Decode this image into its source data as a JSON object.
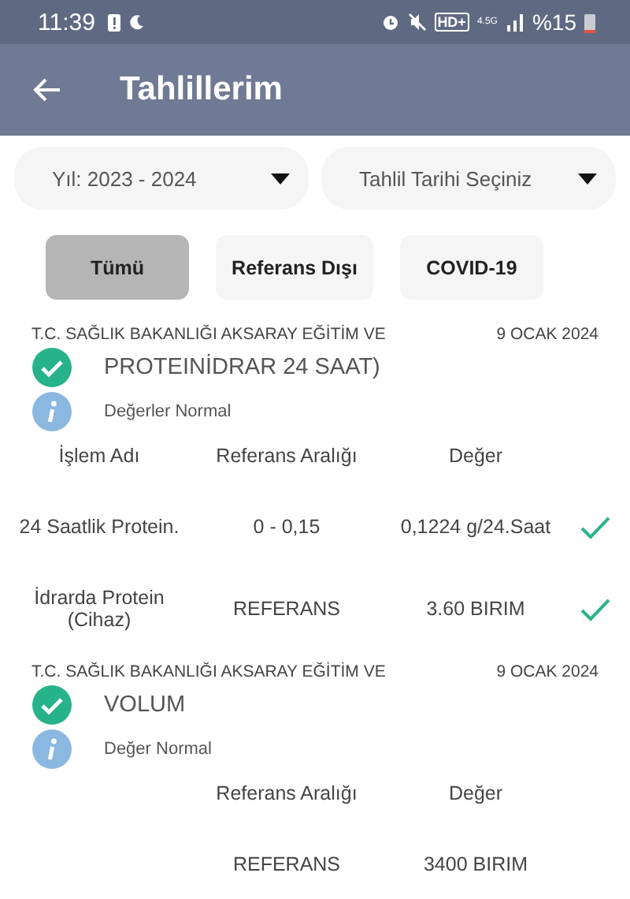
{
  "status_bar": {
    "time": "11:39",
    "hd": "HD+",
    "network": "4.5G",
    "battery": "%15"
  },
  "header": {
    "title": "Tahlillerim"
  },
  "dropdowns": [
    {
      "value": "Yıl: 2023 - 2024"
    },
    {
      "value": "Tahlil Tarihi Seçiniz"
    }
  ],
  "filters": [
    {
      "label": "Tümü",
      "selected": true
    },
    {
      "label": "Referans Dışı",
      "selected": false
    },
    {
      "label": "COVID-19",
      "selected": false
    }
  ],
  "results": [
    {
      "institution": "T.C. SAĞLIK BAKANLIĞI AKSARAY EĞİTİM VE",
      "date": "9 OCAK 2024",
      "test": "PROTEINİDRAR 24 SAAT)",
      "normal": true,
      "note": "Değerler Normal",
      "columns": [
        "İşlem Adı",
        "Referans Aralığı",
        "Değer"
      ],
      "rows": [
        {
          "cells": [
            "24 Saatlik Protein.",
            "0 - 0,15",
            "0,1224 g/24.Saat"
          ],
          "checked": true
        },
        {
          "cells": [
            "İdrarda Protein (Cihaz)",
            "REFERANS",
            "3.60 BIRIM"
          ],
          "checked": true
        }
      ]
    },
    {
      "institution": "T.C. SAĞLIK BAKANLIĞI AKSARAY EĞİTİM VE",
      "date": "9 OCAK 2024",
      "test": "VOLUM",
      "normal": true,
      "note": "Değer Normal",
      "columns": [
        "Referans Aralığı",
        "Değer"
      ],
      "rows": [
        {
          "cells": [
            "REFERANS",
            "3400 BIRIM"
          ]
        }
      ]
    }
  ]
}
